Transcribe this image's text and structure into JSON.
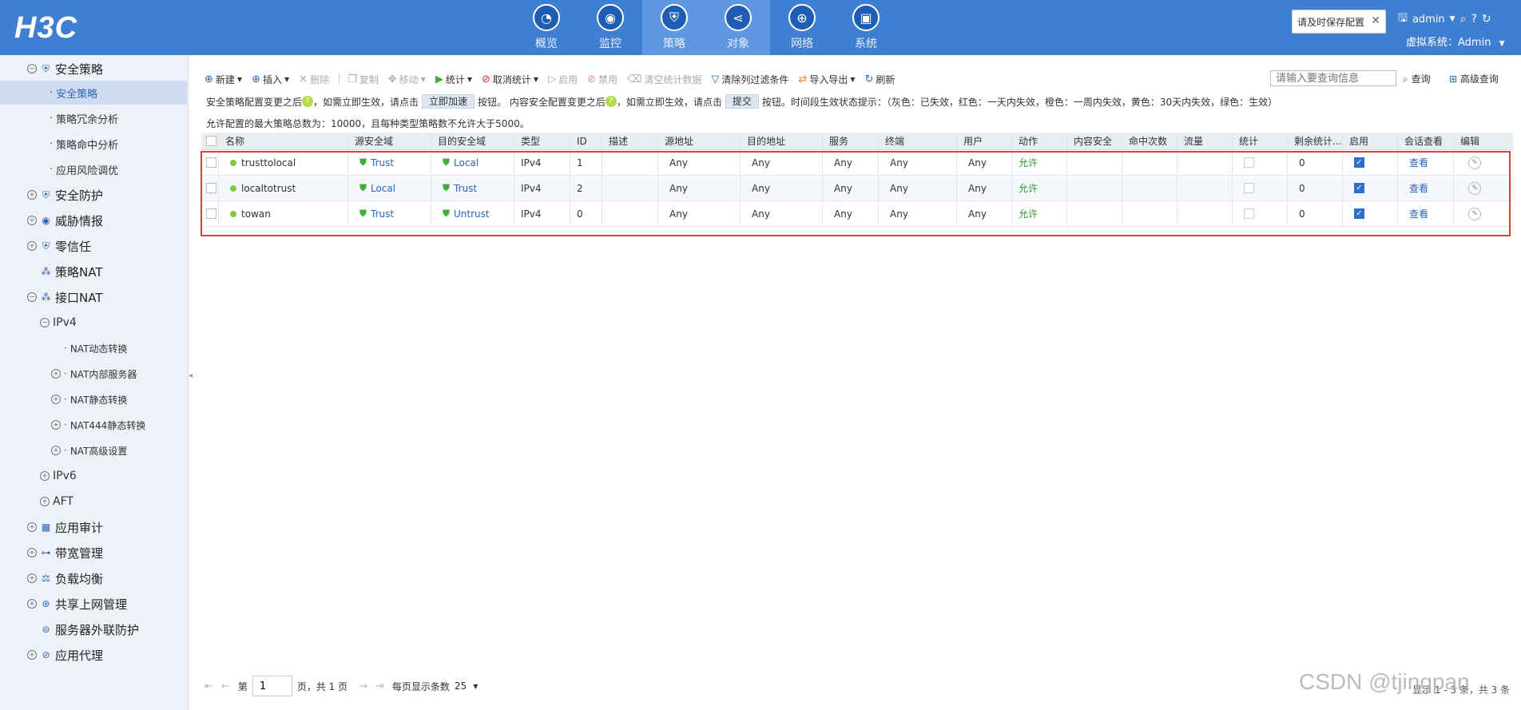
{
  "header": {
    "logo": "H3C",
    "nav": [
      {
        "label": "概览",
        "icon": "dashboard-icon"
      },
      {
        "label": "监控",
        "icon": "monitor-icon"
      },
      {
        "label": "策略",
        "icon": "shield-icon"
      },
      {
        "label": "对象",
        "icon": "share-icon"
      },
      {
        "label": "网络",
        "icon": "globe-icon"
      },
      {
        "label": "系统",
        "icon": "screen-icon"
      }
    ],
    "notice": "请及时保存配置",
    "user": "admin",
    "vsys": "虚拟系统：Admin"
  },
  "sidebar": {
    "items": [
      {
        "label": "安全策略"
      },
      {
        "label": "安全策略"
      },
      {
        "label": "策略冗余分析"
      },
      {
        "label": "策略命中分析"
      },
      {
        "label": "应用风险调优"
      },
      {
        "label": "安全防护"
      },
      {
        "label": "威胁情报"
      },
      {
        "label": "零信任"
      },
      {
        "label": "策略NAT"
      },
      {
        "label": "接口NAT"
      },
      {
        "label": "IPv4"
      },
      {
        "label": "NAT动态转换"
      },
      {
        "label": "NAT内部服务器"
      },
      {
        "label": "NAT静态转换"
      },
      {
        "label": "NAT444静态转换"
      },
      {
        "label": "NAT高级设置"
      },
      {
        "label": "IPv6"
      },
      {
        "label": "AFT"
      },
      {
        "label": "应用审计"
      },
      {
        "label": "带宽管理"
      },
      {
        "label": "负载均衡"
      },
      {
        "label": "共享上网管理"
      },
      {
        "label": "服务器外联防护"
      },
      {
        "label": "应用代理"
      }
    ]
  },
  "toolbar": {
    "new": "新建",
    "insert": "插入",
    "delete": "删除",
    "copy": "复制",
    "move": "移动",
    "stats": "统计",
    "cancel_stats": "取消统计",
    "enable": "启用",
    "disable": "禁用",
    "clear_stats": "清空统计数据",
    "clear_filter": "清除列过滤条件",
    "import_export": "导入导出",
    "refresh": "刷新",
    "search_placeholder": "请输入要查询信息",
    "search": "查询",
    "advanced": "高级查询"
  },
  "info": {
    "line1_a": "安全策略配置变更之后",
    "line1_b": "，如需立即生效，请点击",
    "accelerate": "立即加速",
    "line1_c": "按钮。 内容安全配置变更之后",
    "line1_d": "，如需立即生效，请点击",
    "submit": "提交",
    "line1_e": "按钮。时间段生效状态提示：（灰色：已失效，红色：一天内失效，橙色：一周内失效，黄色：30天内失效，绿色：生效）",
    "line2": "允许配置的最大策略总数为：10000，且每种类型策略数不允许大于5000。"
  },
  "table": {
    "columns": [
      "名称",
      "源安全域",
      "目的安全域",
      "类型",
      "ID",
      "描述",
      "源地址",
      "目的地址",
      "服务",
      "终端",
      "用户",
      "动作",
      "内容安全",
      "命中次数",
      "流量",
      "统计",
      "剩余统计...",
      "启用",
      "会话查看",
      "编辑"
    ],
    "rows": [
      {
        "name": "trusttolocal",
        "src_zone": "Trust",
        "dst_zone": "Local",
        "type": "IPv4",
        "id": "1",
        "desc": "",
        "src_addr": "Any",
        "dst_addr": "Any",
        "service": "Any",
        "terminal": "Any",
        "user": "Any",
        "action": "允许",
        "content": "",
        "hits": "",
        "traffic": "",
        "remaining": "0",
        "view": "查看"
      },
      {
        "name": "localtotrust",
        "src_zone": "Local",
        "dst_zone": "Trust",
        "type": "IPv4",
        "id": "2",
        "desc": "",
        "src_addr": "Any",
        "dst_addr": "Any",
        "service": "Any",
        "terminal": "Any",
        "user": "Any",
        "action": "允许",
        "content": "",
        "hits": "",
        "traffic": "",
        "remaining": "0",
        "view": "查看"
      },
      {
        "name": "towan",
        "src_zone": "Trust",
        "dst_zone": "Untrust",
        "type": "IPv4",
        "id": "0",
        "desc": "",
        "src_addr": "Any",
        "dst_addr": "Any",
        "service": "Any",
        "terminal": "Any",
        "user": "Any",
        "action": "允许",
        "content": "",
        "hits": "",
        "traffic": "",
        "remaining": "0",
        "view": "查看"
      }
    ]
  },
  "pager": {
    "page_prefix": "第",
    "page": "1",
    "page_suffix": "页，共 1 页",
    "per_page_label": "每页显示条数",
    "per_page": "25",
    "right": "显示 1 - 3 条，共 3 条"
  },
  "watermark": "CSDN @tjingpan"
}
